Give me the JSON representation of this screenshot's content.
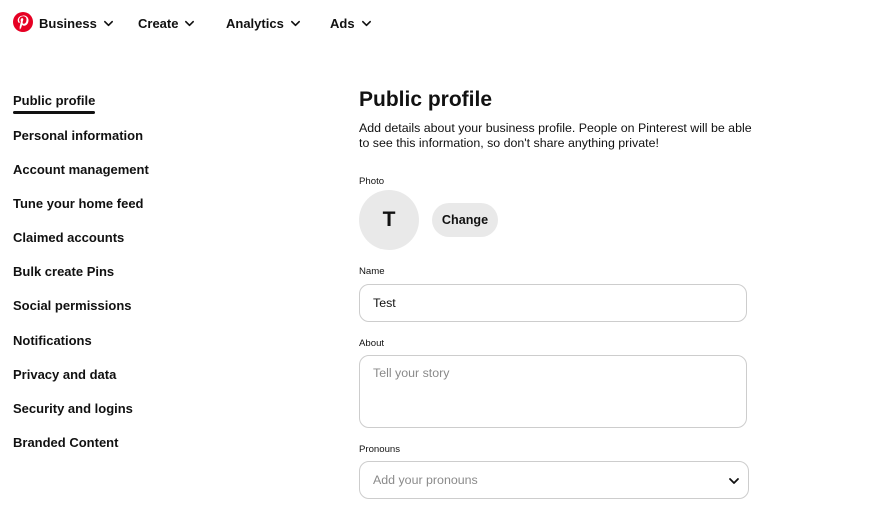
{
  "topnav": {
    "logo_name": "pinterest-logo",
    "items": [
      {
        "label": "Business"
      },
      {
        "label": "Create"
      },
      {
        "label": "Analytics"
      },
      {
        "label": "Ads"
      }
    ]
  },
  "sidebar": {
    "items": [
      {
        "label": "Public profile",
        "active": true
      },
      {
        "label": "Personal information"
      },
      {
        "label": "Account management"
      },
      {
        "label": "Tune your home feed"
      },
      {
        "label": "Claimed accounts"
      },
      {
        "label": "Bulk create Pins"
      },
      {
        "label": "Social permissions"
      },
      {
        "label": "Notifications"
      },
      {
        "label": "Privacy and data"
      },
      {
        "label": "Security and logins"
      },
      {
        "label": "Branded Content"
      }
    ]
  },
  "main": {
    "title": "Public profile",
    "description": "Add details about your business profile. People on Pinterest will be able to see this information, so don't share anything private!",
    "photo": {
      "label": "Photo",
      "initial": "T",
      "change_label": "Change"
    },
    "name": {
      "label": "Name",
      "value": "Test"
    },
    "about": {
      "label": "About",
      "placeholder": "Tell your story"
    },
    "pronouns": {
      "label": "Pronouns",
      "placeholder": "Add your pronouns"
    }
  },
  "colors": {
    "brand": "#e60023",
    "text": "#111111",
    "muted_bg": "#e9e9e9",
    "border": "#cdcdcd",
    "placeholder": "#8a8a8a"
  }
}
